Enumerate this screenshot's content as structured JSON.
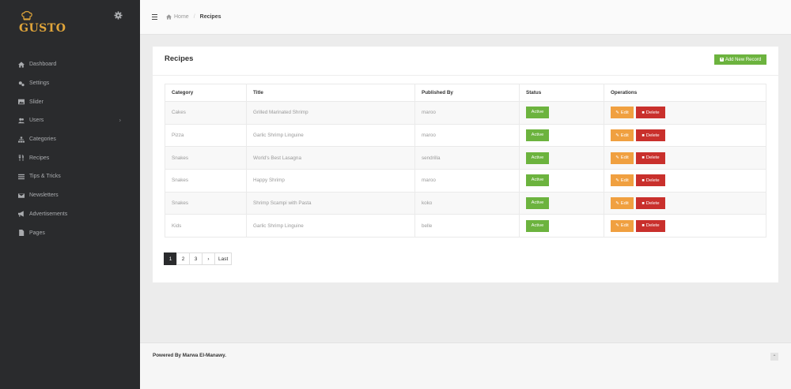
{
  "app": {
    "logo_text": "GUSTO"
  },
  "sidebar": {
    "items": [
      {
        "label": "Dashboard",
        "icon": "home-icon"
      },
      {
        "label": "Settings",
        "icon": "cogs-icon"
      },
      {
        "label": "Slider",
        "icon": "image-icon"
      },
      {
        "label": "Users",
        "icon": "users-icon",
        "has_submenu": true
      },
      {
        "label": "Categories",
        "icon": "sitemap-icon"
      },
      {
        "label": "Recipes",
        "icon": "cutlery-icon"
      },
      {
        "label": "Tips & Tricks",
        "icon": "list-icon"
      },
      {
        "label": "Newsletters",
        "icon": "envelope-icon"
      },
      {
        "label": "Advertisements",
        "icon": "bullhorn-icon"
      },
      {
        "label": "Pages",
        "icon": "file-icon"
      }
    ],
    "submenu_chevron": "›"
  },
  "breadcrumb": {
    "home": "Home",
    "separator": "/",
    "current": "Recipes"
  },
  "panel": {
    "title": "Recipes",
    "add_button": "Add New Record",
    "table": {
      "headers": [
        "Category",
        "Title",
        "Published By",
        "Status",
        "Operations"
      ],
      "rows": [
        {
          "category": "Cakes",
          "title": "Grilled Marinated Shrimp",
          "published_by": "maroo",
          "status": "Active"
        },
        {
          "category": "Pizza",
          "title": "Garlic Shrimp Linguine",
          "published_by": "maroo",
          "status": "Active"
        },
        {
          "category": "Snakes",
          "title": "World's Best Lasagna",
          "published_by": "sendrilla",
          "status": "Active"
        },
        {
          "category": "Snakes",
          "title": "Happy Shrimp",
          "published_by": "maroo",
          "status": "Active"
        },
        {
          "category": "Snakes",
          "title": "Shrimp Scampi with Pasta",
          "published_by": "koko",
          "status": "Active"
        },
        {
          "category": "Kids",
          "title": "Garlic Shrimp Linguine",
          "published_by": "belle",
          "status": "Active"
        }
      ],
      "edit_label": "Edit",
      "delete_label": "Delete"
    },
    "pagination": [
      "1",
      "2",
      "3",
      "›",
      "Last"
    ],
    "active_page": "1"
  },
  "footer": {
    "text": "Powered By Marwa El-Manawy.",
    "scroll_top": "⌃"
  },
  "colors": {
    "sidebar_bg": "#2a2b2d",
    "brand": "#e0a53a",
    "success": "#6cb33e",
    "warning": "#f0a040",
    "danger": "#c9302c"
  }
}
